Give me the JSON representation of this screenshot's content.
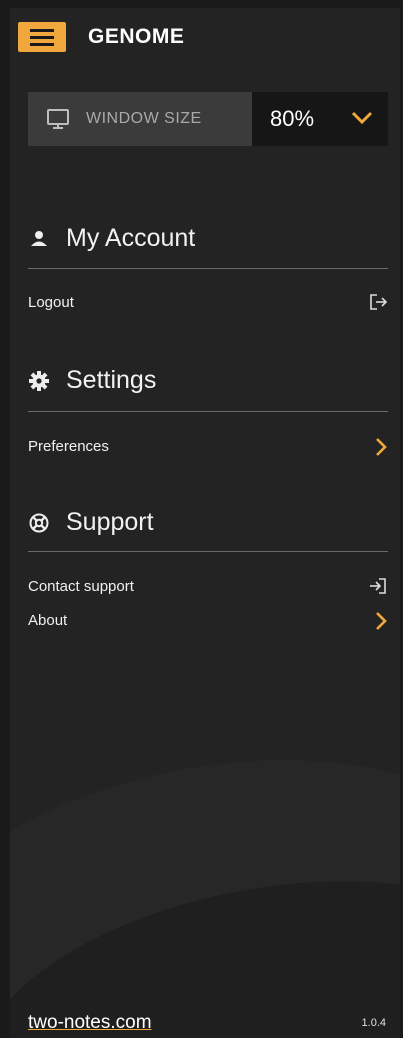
{
  "app": {
    "brand": "GENOME"
  },
  "window_size": {
    "label": "WINDOW SIZE",
    "value": "80%"
  },
  "sections": {
    "account": {
      "title": "My Account",
      "items": [
        {
          "label": "Logout",
          "icon": "logout-icon"
        }
      ]
    },
    "settings": {
      "title": "Settings",
      "items": [
        {
          "label": "Preferences",
          "icon": "chevron-right-icon"
        }
      ]
    },
    "support": {
      "title": "Support",
      "items": [
        {
          "label": "Contact support",
          "icon": "login-icon"
        },
        {
          "label": "About",
          "icon": "chevron-right-icon"
        }
      ]
    }
  },
  "footer": {
    "site": "two-notes.com",
    "version": "1.0.4"
  },
  "colors": {
    "accent": "#f0a83c",
    "panel": "#232323",
    "background": "#1a1a1a"
  }
}
